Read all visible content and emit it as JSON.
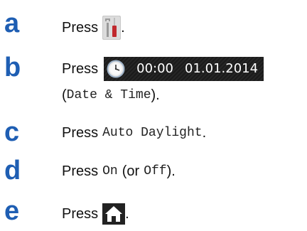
{
  "steps": [
    {
      "letter": "a",
      "press": "Press",
      "suffix": "."
    },
    {
      "letter": "b",
      "press": "Press",
      "time": "00:00",
      "date": "01.01.2014",
      "menu": "Date & Time",
      "open_paren": "(",
      "close_paren": ")."
    },
    {
      "letter": "c",
      "press": "Press",
      "menu": "Auto Daylight",
      "suffix": "."
    },
    {
      "letter": "d",
      "press": "Press",
      "on": "On",
      "or_open": "(or",
      "off": "Off",
      "close": ")."
    },
    {
      "letter": "e",
      "press": "Press",
      "suffix": "."
    }
  ],
  "icons": {
    "step_a": "tools-settings-icon",
    "step_b": "clock-icon",
    "step_e": "home-icon"
  },
  "colors": {
    "letter": "#1e5eb3",
    "date_bar": "#1b1b1b",
    "tools_handle": "#c0282d"
  }
}
